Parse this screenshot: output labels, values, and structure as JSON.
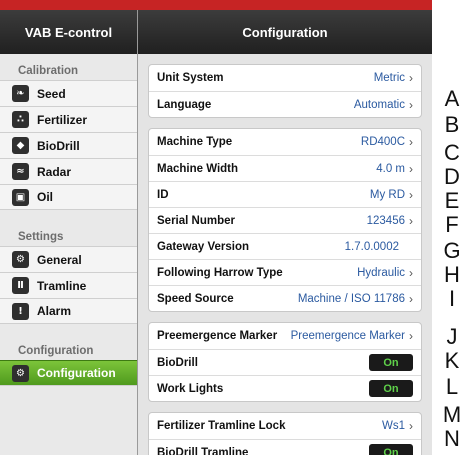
{
  "sidebar": {
    "title": "VAB E-control",
    "sections": [
      {
        "label": "Calibration",
        "items": [
          {
            "label": "Seed",
            "icon": "seed-icon",
            "glyph": "❧"
          },
          {
            "label": "Fertilizer",
            "icon": "fertilizer-icon",
            "glyph": "∴"
          },
          {
            "label": "BioDrill",
            "icon": "drop-icon",
            "glyph": "◆"
          },
          {
            "label": "Radar",
            "icon": "radar-icon",
            "glyph": "≈"
          },
          {
            "label": "Oil",
            "icon": "oil-icon",
            "glyph": "▣"
          }
        ]
      },
      {
        "label": "Settings",
        "items": [
          {
            "label": "General",
            "icon": "gear-icon",
            "glyph": "⚙"
          },
          {
            "label": "Tramline",
            "icon": "tramline-icon",
            "glyph": "Ⅱ"
          },
          {
            "label": "Alarm",
            "icon": "alarm-icon",
            "glyph": "!"
          }
        ]
      },
      {
        "label": "Configuration",
        "items": [
          {
            "label": "Configuration",
            "icon": "config-icon",
            "glyph": "⚙",
            "active": true
          }
        ]
      }
    ]
  },
  "main": {
    "title": "Configuration",
    "groups": [
      [
        {
          "label": "Unit System",
          "value": "Metric",
          "chevron": true
        },
        {
          "label": "Language",
          "value": "Automatic",
          "chevron": true
        }
      ],
      [
        {
          "label": "Machine Type",
          "value": "RD400C",
          "chevron": true
        },
        {
          "label": "Machine Width",
          "value": "4.0 m",
          "chevron": true
        },
        {
          "label": "ID",
          "value": "My RD",
          "chevron": true
        },
        {
          "label": "Serial Number",
          "value": "123456",
          "chevron": true
        },
        {
          "label": "Gateway Version",
          "value": "1.7.0.0002",
          "chevron": false
        },
        {
          "label": "Following Harrow Type",
          "value": "Hydraulic",
          "chevron": true
        },
        {
          "label": "Speed Source",
          "value": "Machine / ISO 11786",
          "chevron": true
        }
      ],
      [
        {
          "label": "Preemergence Marker",
          "value": "Preemergence Marker",
          "chevron": true
        },
        {
          "label": "BioDrill",
          "toggle": "On"
        },
        {
          "label": "Work Lights",
          "toggle": "On"
        }
      ],
      [
        {
          "label": "Fertilizer Tramline Lock",
          "value": "Ws1",
          "chevron": true
        },
        {
          "label": "BioDrill Tramline",
          "toggle": "On"
        }
      ]
    ]
  },
  "index_letters": [
    "A",
    "B",
    "C",
    "D",
    "E",
    "F",
    "G",
    "H",
    "I",
    "J",
    "K",
    "L",
    "M",
    "N"
  ],
  "colors": {
    "accent": "#5fb02a",
    "value_text": "#2b5aa0",
    "toggle_on": "#5fd14a",
    "topbar": "#c62424"
  }
}
